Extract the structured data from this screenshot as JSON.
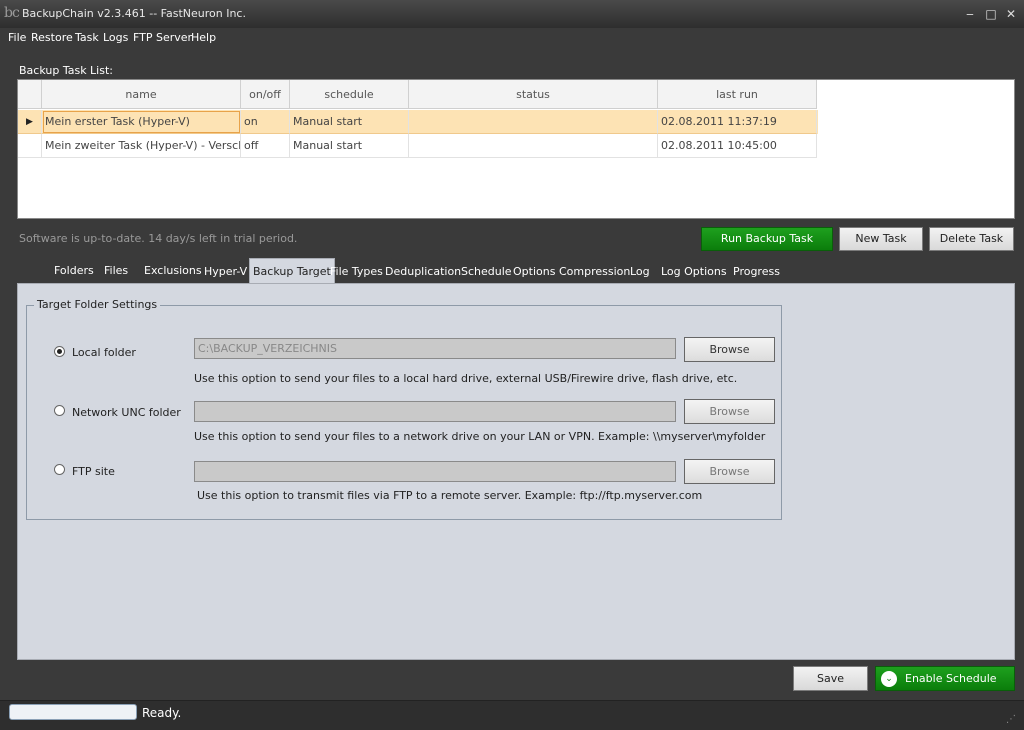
{
  "window": {
    "title": "BackupChain v2.3.461 -- FastNeuron Inc.",
    "app_icon_text": "bc"
  },
  "menu": [
    "File",
    "Restore",
    "Task",
    "Logs",
    "FTP Server",
    "Help"
  ],
  "task_list": {
    "label": "Backup Task List:",
    "columns": [
      "name",
      "on/off",
      "schedule",
      "status",
      "last run"
    ],
    "rows": [
      {
        "name": "Mein erster Task (Hyper-V)",
        "onoff": "on",
        "schedule": "Manual start",
        "status": "",
        "last_run": "02.08.2011 11:37:19",
        "selected": true
      },
      {
        "name": "Mein zweiter Task (Hyper-V) - Versch...",
        "onoff": "off",
        "schedule": "Manual start",
        "status": "",
        "last_run": "02.08.2011 10:45:00",
        "selected": false
      }
    ]
  },
  "trial_status": "Software is up-to-date. 14 day/s left in trial period.",
  "buttons": {
    "run": "Run Backup Task",
    "new": "New Task",
    "delete": "Delete Task",
    "save": "Save",
    "enable_schedule": "Enable Schedule"
  },
  "tabs": [
    "Folders",
    "Files",
    "Exclusions",
    "Hyper-V",
    "Backup Target",
    "File Types",
    "Deduplication",
    "Schedule",
    "Options",
    "Compression",
    "Log",
    "Log Options",
    "Progress"
  ],
  "active_tab": "Backup Target",
  "target": {
    "group_title": "Target Folder Settings",
    "local": {
      "label": "Local folder",
      "value": "C:\\BACKUP_VERZEICHNIS",
      "browse": "Browse",
      "hint": "Use this option to send your files to a local hard drive, external USB/Firewire drive, flash drive, etc.",
      "checked": true
    },
    "unc": {
      "label": "Network UNC folder",
      "value": "",
      "browse": "Browse",
      "hint": "Use this option to send your files to a network drive on your LAN or VPN. Example: \\\\myserver\\myfolder",
      "checked": false
    },
    "ftp": {
      "label": "FTP site",
      "value": "",
      "browse": "Browse",
      "hint": "Use this option to transmit files via FTP to a remote server. Example: ftp://ftp.myserver.com",
      "checked": false
    }
  },
  "status_bar": {
    "text": "Ready."
  },
  "colors": {
    "accent_green": "#0b7d0b",
    "selection": "#fde3b4",
    "panel": "#d4d8e0"
  }
}
